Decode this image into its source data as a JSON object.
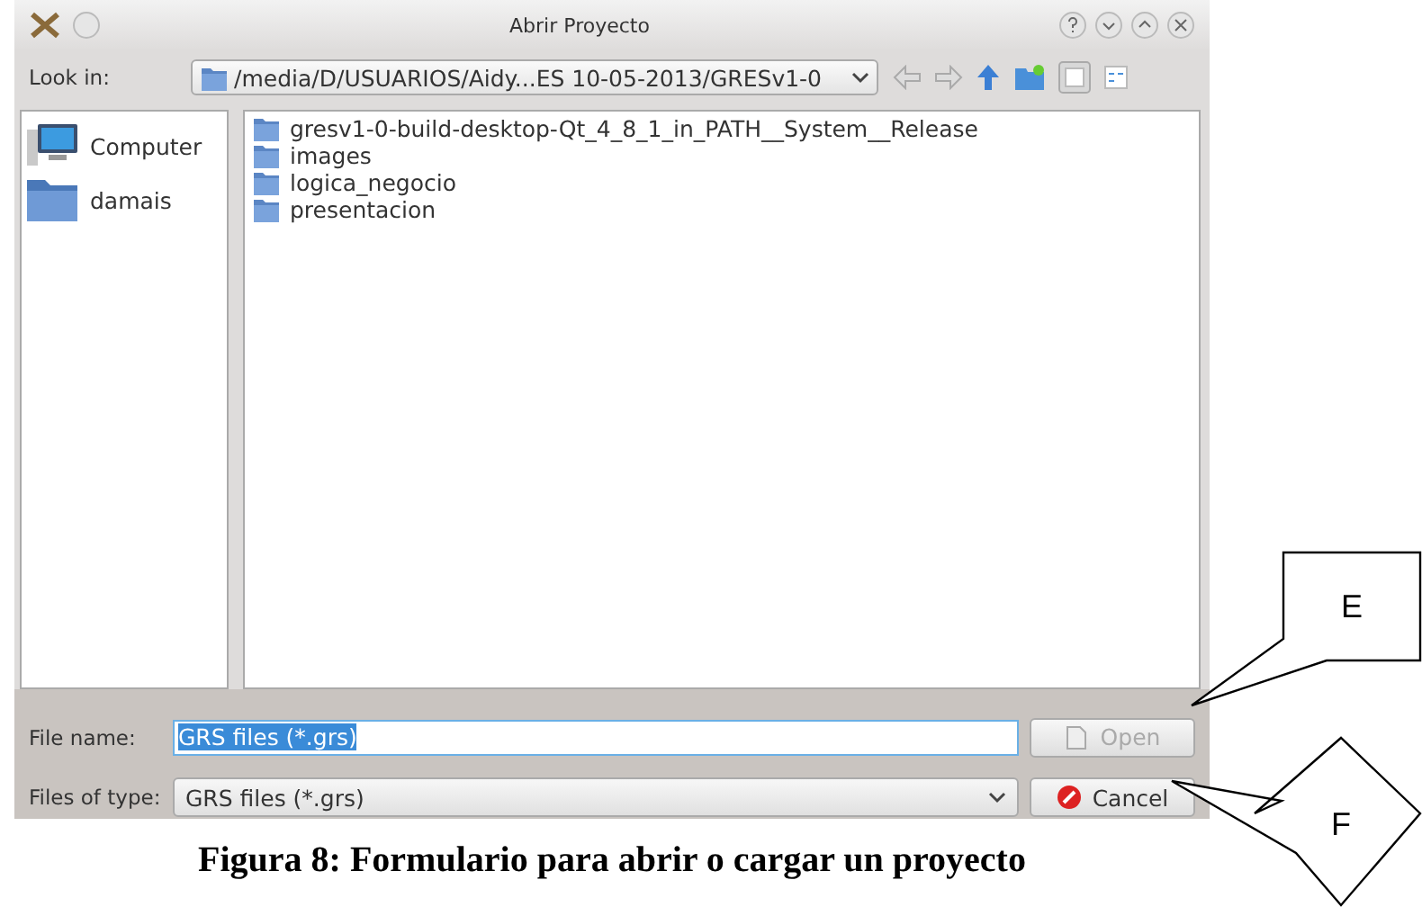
{
  "window": {
    "title": "Abrir Proyecto"
  },
  "look_in": {
    "label": "Look in:",
    "path": "/media/D/USUARIOS/Aidy...ES 10-05-2013/GRESv1-0"
  },
  "places": [
    {
      "label": "Computer",
      "kind": "computer",
      "selected": false
    },
    {
      "label": "damais",
      "kind": "folder",
      "selected": false
    }
  ],
  "files": [
    {
      "name": "gresv1-0-build-desktop-Qt_4_8_1_in_PATH__System__Release"
    },
    {
      "name": "images"
    },
    {
      "name": "logica_negocio"
    },
    {
      "name": "presentacion"
    }
  ],
  "file_name": {
    "label": "File name:",
    "value": "GRS files (*.grs)"
  },
  "file_type": {
    "label": "Files of type:",
    "value": "GRS files (*.grs)"
  },
  "buttons": [
    {
      "label": "Open",
      "kind": "open",
      "disabled": true
    },
    {
      "label": "Cancel",
      "kind": "cancel",
      "disabled": false
    }
  ],
  "callouts": [
    {
      "label": "E",
      "kind": "box"
    },
    {
      "label": "F",
      "kind": "diamond"
    }
  ],
  "caption": "Figura 8: Formulario para abrir o cargar un proyecto"
}
